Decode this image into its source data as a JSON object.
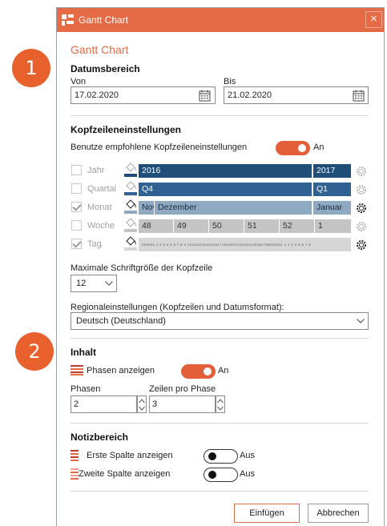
{
  "callouts": {
    "one": "1",
    "two": "2"
  },
  "window": {
    "title": "Gantt Chart",
    "close": "×"
  },
  "section_title": "Gantt Chart",
  "datumsbereich": {
    "heading": "Datumsbereich",
    "von_label": "Von",
    "von_value": "17.02.2020",
    "bis_label": "Bis",
    "bis_value": "21.02.2020"
  },
  "kopfzeilen": {
    "heading": "Kopfzeileneinstellungen",
    "recommended_label": "Benutze empfohlene Kopfzeileneinstellungen",
    "recommended_state": "An",
    "rows": [
      {
        "label": "Jahr",
        "checked": false
      },
      {
        "label": "Quartal",
        "checked": false
      },
      {
        "label": "Monat",
        "checked": true
      },
      {
        "label": "Woche",
        "checked": false
      },
      {
        "label": "Tag",
        "checked": true
      }
    ],
    "jahr_cells": [
      "2016",
      "2017"
    ],
    "quartal_cells": [
      "Q4",
      "Q1"
    ],
    "monat_cells": [
      "Nov",
      "Dezember",
      "Januar"
    ],
    "woche_cells": [
      "48",
      "49",
      "50",
      "51",
      "52",
      "1"
    ],
    "tag_cells": "282930 1 2 3 4 5 6 7 8 9 10111213141516171819202122232425262728293031 1 2 3 4 5 6 7 8",
    "font_size_label": "Maximale Schriftgröße der Kopfzeile",
    "font_size_value": "12",
    "regional_label": "Regionaleinstellungen (Kopfzeilen und Datumsformat):",
    "regional_value": "Deutsch (Deutschland)"
  },
  "inhalt": {
    "heading": "Inhalt",
    "phasen_label": "Phasen anzeigen",
    "phasen_state": "An",
    "phasen_count_label": "Phasen",
    "phasen_count_value": "2",
    "zeilen_label": "Zeilen pro Phase",
    "zeilen_value": "3"
  },
  "notiz": {
    "heading": "Notizbereich",
    "first_label": "Erste Spalte anzeigen",
    "first_state": "Aus",
    "second_label": "Zweite Spalte anzeigen",
    "second_state": "Aus"
  },
  "buttons": {
    "insert": "Einfügen",
    "cancel": "Abbrechen"
  },
  "colors": {
    "accent": "#e46b45",
    "navy": "#1f4e79",
    "toggle_on": "#e25f39"
  }
}
